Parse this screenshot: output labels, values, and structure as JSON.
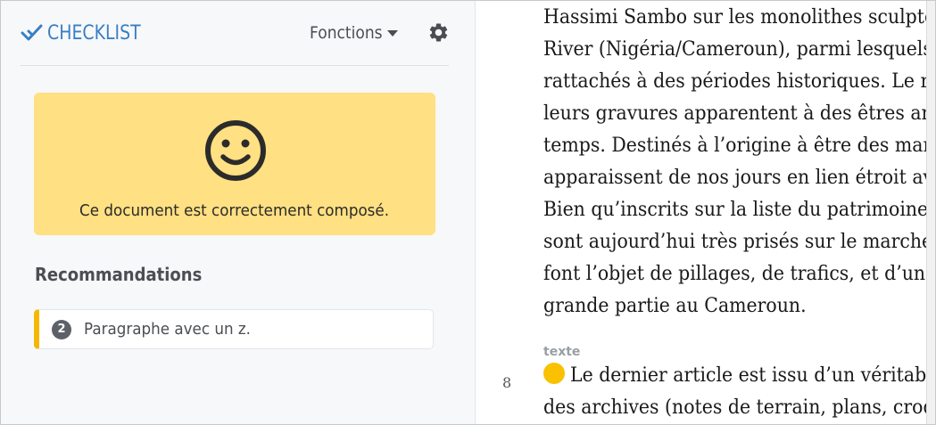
{
  "app": {
    "logo_text": "CHECKLIST",
    "menu_label": "Fonctions",
    "accent_color": "#3a7fc4"
  },
  "status": {
    "message": "Ce document est correctement composé.",
    "icon": "smiley-face-icon",
    "background_color": "#ffe082"
  },
  "recommendations": {
    "heading": "Recommandations",
    "items": [
      {
        "count": "2",
        "label": "Paragraphe avec un z.",
        "accent_color": "#f5b800"
      }
    ]
  },
  "document": {
    "lines": [
      "Hassimi Sambo sur les monolithes sculpte",
      "River (Nigéria/Cameroun), parmi lesquels",
      "rattachés à des périodes historiques. Le rô",
      "leurs gravures apparentent à des êtres anc",
      "temps. Destinés à l’origine à être des marc",
      "apparaissent de nos jours en lien étroit av",
      "Bien qu’inscrits sur la liste du patrimoine",
      "sont aujourd’hui très prisés sur le marché",
      "font l’objet de pillages, de trafics, et d’un n",
      "grande partie au Cameroun."
    ],
    "next_block": {
      "tag": "texte",
      "number": "8",
      "lines": [
        "Le dernier article est issu d’un véritable",
        "des archives (notes de terrain, plans, croq"
      ]
    }
  }
}
